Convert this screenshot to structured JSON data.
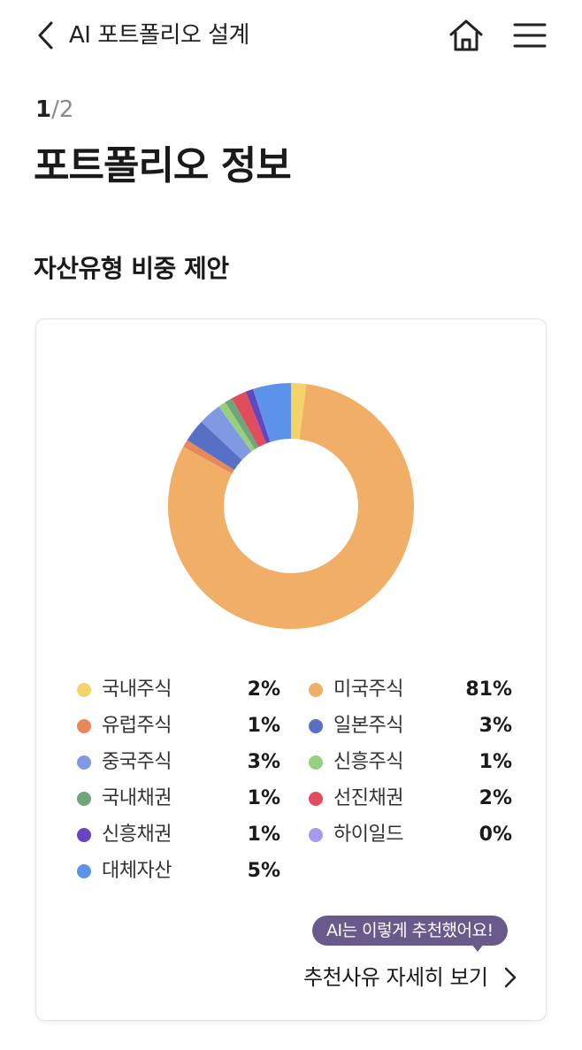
{
  "header": {
    "title": "AI 포트폴리오 설계",
    "back_icon": "chevron-left-icon",
    "home_icon": "home-icon",
    "menu_icon": "hamburger-menu-icon"
  },
  "step": {
    "current": "1",
    "separator": "/",
    "total": "2"
  },
  "page_title": "포트폴리오 정보",
  "section_title": "자산유형 비중 제안",
  "chart_data": {
    "type": "pie",
    "categories": [
      "국내주식",
      "미국주식",
      "유럽주식",
      "일본주식",
      "중국주식",
      "신흥주식",
      "국내채권",
      "선진채권",
      "신흥채권",
      "하이일드",
      "대체자산"
    ],
    "values": [
      2,
      81,
      1,
      3,
      3,
      1,
      1,
      2,
      1,
      0,
      5
    ],
    "colors": [
      "#F5D36B",
      "#F0AE66",
      "#E8875A",
      "#5570C4",
      "#8199E3",
      "#98CF7E",
      "#6FA679",
      "#E14D5C",
      "#6446BE",
      "#A59AEC",
      "#5E93EC"
    ],
    "unit": "%",
    "title": "",
    "legend": "bottom"
  },
  "legend": {
    "items": [
      {
        "label": "국내주식",
        "value": "2",
        "unit": "%",
        "color": "#F5D36B"
      },
      {
        "label": "미국주식",
        "value": "81",
        "unit": "%",
        "color": "#F0AE66"
      },
      {
        "label": "유럽주식",
        "value": "1",
        "unit": "%",
        "color": "#E8875A"
      },
      {
        "label": "일본주식",
        "value": "3",
        "unit": "%",
        "color": "#5570C4"
      },
      {
        "label": "중국주식",
        "value": "3",
        "unit": "%",
        "color": "#8199E3"
      },
      {
        "label": "신흥주식",
        "value": "1",
        "unit": "%",
        "color": "#98CF7E"
      },
      {
        "label": "국내채권",
        "value": "1",
        "unit": "%",
        "color": "#6FA679"
      },
      {
        "label": "선진채권",
        "value": "2",
        "unit": "%",
        "color": "#E14D5C"
      },
      {
        "label": "신흥채권",
        "value": "1",
        "unit": "%",
        "color": "#6446BE"
      },
      {
        "label": "하이일드",
        "value": "0",
        "unit": "%",
        "color": "#A59AEC"
      },
      {
        "label": "대체자산",
        "value": "5",
        "unit": "%",
        "color": "#5E93EC"
      }
    ]
  },
  "tooltip": {
    "text": "AI는 이렇게 추천했어요!",
    "color": "#6A5A8C"
  },
  "reason_link": {
    "label": "추천사유 자세히 보기",
    "icon": "chevron-right-icon"
  }
}
